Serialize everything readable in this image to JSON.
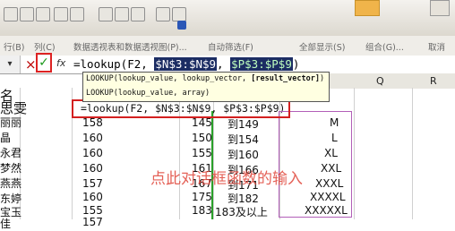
{
  "toolbar_row2": {
    "items": [
      "行(B)",
      "列(C)",
      "数据透视表和数据透视图(P)...",
      "自动筛选(F)",
      "全部显示(S)",
      "组合(G)...",
      "取消"
    ]
  },
  "formula_bar": {
    "cancel_symbol": "×",
    "ok_symbol": "✓",
    "fx_symbol": "fx",
    "formula_prefix": "=lookup(F2, ",
    "arg1": "$N$3:$N$9",
    "sep": ", ",
    "arg2": "$P$3:$P$9",
    "close": ")"
  },
  "tooltip": {
    "line1_prefix": "LOOKUP(lookup_value, lookup_vector, ",
    "line1_bold": "[result_vector]",
    "line1_suffix": ")",
    "line2": "LOOKUP(lookup_value, array)"
  },
  "columns": [
    "Q",
    "R"
  ],
  "rows": [
    {
      "name": "名",
      "b": ""
    },
    {
      "name": "思雯",
      "b": "=lookup(F2, $N$3:$N$9, $P$3:$P$9)"
    },
    {
      "name": "丽丽",
      "b": "158",
      "n": "145",
      "o": "到149",
      "p": "M"
    },
    {
      "name": "晶",
      "b": "160",
      "n": "150",
      "o": "到154",
      "p": "L"
    },
    {
      "name": "永君",
      "b": "160",
      "n": "155",
      "o": "到160",
      "p": "XL"
    },
    {
      "name": "梦然",
      "b": "160",
      "n": "161",
      "o": "到166",
      "p": "XXL"
    },
    {
      "name": "燕燕",
      "b": "157",
      "n": "167",
      "o": "到171",
      "p": "XXXL"
    },
    {
      "name": "东婷",
      "b": "160",
      "n": "175",
      "o": "到182",
      "p": "XXXXL"
    },
    {
      "name": "宝玉",
      "b": "155",
      "n": "183",
      "o": "183及以上",
      "p": "XXXXXL"
    },
    {
      "name": "佳",
      "b": "157"
    }
  ],
  "annotation": "点此对话框函数的输入"
}
